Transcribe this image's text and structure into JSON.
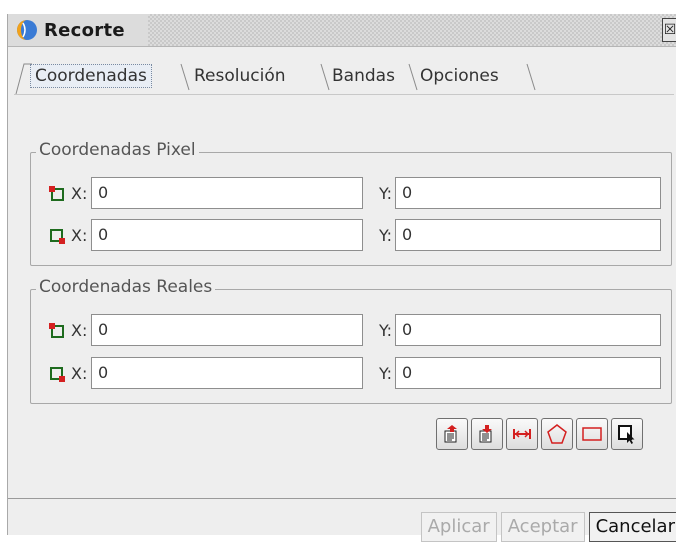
{
  "window": {
    "title": "Recorte",
    "close_glyph": "☒"
  },
  "tabs": [
    {
      "label": "Coordenadas",
      "active": true
    },
    {
      "label": "Resolución"
    },
    {
      "label": "Bandas"
    },
    {
      "label": "Opciones"
    }
  ],
  "pixel_group": {
    "legend": "Coordenadas Pixel",
    "rows": [
      {
        "icon": "upper-left-corner-icon",
        "x_label": "X:",
        "x_value": "0",
        "y_label": "Y:",
        "y_value": "0"
      },
      {
        "icon": "lower-right-corner-icon",
        "x_label": "X:",
        "x_value": "0",
        "y_label": "Y:",
        "y_value": "0"
      }
    ]
  },
  "real_group": {
    "legend": "Coordenadas Reales",
    "rows": [
      {
        "icon": "upper-left-corner-icon",
        "x_label": "X:",
        "x_value": "0",
        "y_label": "Y:",
        "y_value": "0"
      },
      {
        "icon": "lower-right-corner-icon",
        "x_label": "X:",
        "x_value": "0",
        "y_label": "Y:",
        "y_value": "0"
      }
    ]
  },
  "toolbar": [
    "load-coordinates-icon",
    "save-coordinates-icon",
    "full-extent-icon",
    "polygon-select-icon",
    "rectangle-select-icon",
    "pointer-select-icon"
  ],
  "buttons": {
    "apply": "Aplicar",
    "accept": "Aceptar",
    "cancel": "Cancelar"
  },
  "colors": {
    "accent_red": "#d42020",
    "icon_green": "#1e6b1e",
    "window_bg": "#eeeeee"
  }
}
